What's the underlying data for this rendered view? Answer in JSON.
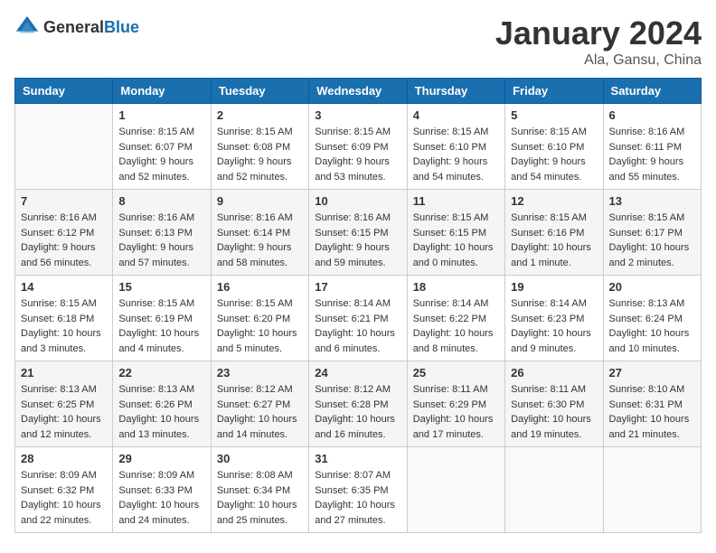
{
  "header": {
    "logo_general": "General",
    "logo_blue": "Blue",
    "month_title": "January 2024",
    "location": "Ala, Gansu, China"
  },
  "calendar": {
    "days_of_week": [
      "Sunday",
      "Monday",
      "Tuesday",
      "Wednesday",
      "Thursday",
      "Friday",
      "Saturday"
    ],
    "weeks": [
      [
        {
          "day": "",
          "info": ""
        },
        {
          "day": "1",
          "info": "Sunrise: 8:15 AM\nSunset: 6:07 PM\nDaylight: 9 hours\nand 52 minutes."
        },
        {
          "day": "2",
          "info": "Sunrise: 8:15 AM\nSunset: 6:08 PM\nDaylight: 9 hours\nand 52 minutes."
        },
        {
          "day": "3",
          "info": "Sunrise: 8:15 AM\nSunset: 6:09 PM\nDaylight: 9 hours\nand 53 minutes."
        },
        {
          "day": "4",
          "info": "Sunrise: 8:15 AM\nSunset: 6:10 PM\nDaylight: 9 hours\nand 54 minutes."
        },
        {
          "day": "5",
          "info": "Sunrise: 8:15 AM\nSunset: 6:10 PM\nDaylight: 9 hours\nand 54 minutes."
        },
        {
          "day": "6",
          "info": "Sunrise: 8:16 AM\nSunset: 6:11 PM\nDaylight: 9 hours\nand 55 minutes."
        }
      ],
      [
        {
          "day": "7",
          "info": "Sunrise: 8:16 AM\nSunset: 6:12 PM\nDaylight: 9 hours\nand 56 minutes."
        },
        {
          "day": "8",
          "info": "Sunrise: 8:16 AM\nSunset: 6:13 PM\nDaylight: 9 hours\nand 57 minutes."
        },
        {
          "day": "9",
          "info": "Sunrise: 8:16 AM\nSunset: 6:14 PM\nDaylight: 9 hours\nand 58 minutes."
        },
        {
          "day": "10",
          "info": "Sunrise: 8:16 AM\nSunset: 6:15 PM\nDaylight: 9 hours\nand 59 minutes."
        },
        {
          "day": "11",
          "info": "Sunrise: 8:15 AM\nSunset: 6:15 PM\nDaylight: 10 hours\nand 0 minutes."
        },
        {
          "day": "12",
          "info": "Sunrise: 8:15 AM\nSunset: 6:16 PM\nDaylight: 10 hours\nand 1 minute."
        },
        {
          "day": "13",
          "info": "Sunrise: 8:15 AM\nSunset: 6:17 PM\nDaylight: 10 hours\nand 2 minutes."
        }
      ],
      [
        {
          "day": "14",
          "info": "Sunrise: 8:15 AM\nSunset: 6:18 PM\nDaylight: 10 hours\nand 3 minutes."
        },
        {
          "day": "15",
          "info": "Sunrise: 8:15 AM\nSunset: 6:19 PM\nDaylight: 10 hours\nand 4 minutes."
        },
        {
          "day": "16",
          "info": "Sunrise: 8:15 AM\nSunset: 6:20 PM\nDaylight: 10 hours\nand 5 minutes."
        },
        {
          "day": "17",
          "info": "Sunrise: 8:14 AM\nSunset: 6:21 PM\nDaylight: 10 hours\nand 6 minutes."
        },
        {
          "day": "18",
          "info": "Sunrise: 8:14 AM\nSunset: 6:22 PM\nDaylight: 10 hours\nand 8 minutes."
        },
        {
          "day": "19",
          "info": "Sunrise: 8:14 AM\nSunset: 6:23 PM\nDaylight: 10 hours\nand 9 minutes."
        },
        {
          "day": "20",
          "info": "Sunrise: 8:13 AM\nSunset: 6:24 PM\nDaylight: 10 hours\nand 10 minutes."
        }
      ],
      [
        {
          "day": "21",
          "info": "Sunrise: 8:13 AM\nSunset: 6:25 PM\nDaylight: 10 hours\nand 12 minutes."
        },
        {
          "day": "22",
          "info": "Sunrise: 8:13 AM\nSunset: 6:26 PM\nDaylight: 10 hours\nand 13 minutes."
        },
        {
          "day": "23",
          "info": "Sunrise: 8:12 AM\nSunset: 6:27 PM\nDaylight: 10 hours\nand 14 minutes."
        },
        {
          "day": "24",
          "info": "Sunrise: 8:12 AM\nSunset: 6:28 PM\nDaylight: 10 hours\nand 16 minutes."
        },
        {
          "day": "25",
          "info": "Sunrise: 8:11 AM\nSunset: 6:29 PM\nDaylight: 10 hours\nand 17 minutes."
        },
        {
          "day": "26",
          "info": "Sunrise: 8:11 AM\nSunset: 6:30 PM\nDaylight: 10 hours\nand 19 minutes."
        },
        {
          "day": "27",
          "info": "Sunrise: 8:10 AM\nSunset: 6:31 PM\nDaylight: 10 hours\nand 21 minutes."
        }
      ],
      [
        {
          "day": "28",
          "info": "Sunrise: 8:09 AM\nSunset: 6:32 PM\nDaylight: 10 hours\nand 22 minutes."
        },
        {
          "day": "29",
          "info": "Sunrise: 8:09 AM\nSunset: 6:33 PM\nDaylight: 10 hours\nand 24 minutes."
        },
        {
          "day": "30",
          "info": "Sunrise: 8:08 AM\nSunset: 6:34 PM\nDaylight: 10 hours\nand 25 minutes."
        },
        {
          "day": "31",
          "info": "Sunrise: 8:07 AM\nSunset: 6:35 PM\nDaylight: 10 hours\nand 27 minutes."
        },
        {
          "day": "",
          "info": ""
        },
        {
          "day": "",
          "info": ""
        },
        {
          "day": "",
          "info": ""
        }
      ]
    ]
  }
}
